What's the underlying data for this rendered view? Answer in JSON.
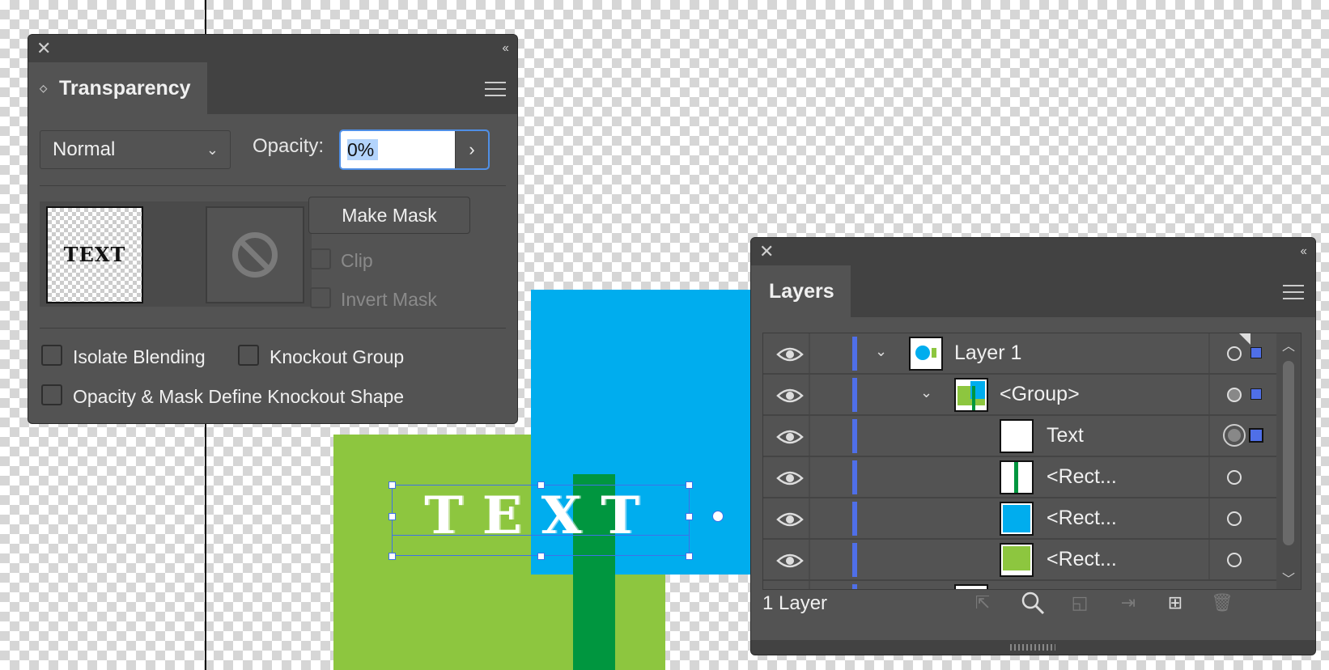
{
  "transparency": {
    "title": "Transparency",
    "blend_mode": "Normal",
    "opacity_label": "Opacity:",
    "opacity_value": "0%",
    "thumbnail_text": "TEXT",
    "make_mask_label": "Make Mask",
    "clip_label": "Clip",
    "invert_mask_label": "Invert Mask",
    "isolate_blending_label": "Isolate Blending",
    "knockout_group_label": "Knockout Group",
    "opacity_mask_knockout_label": "Opacity & Mask Define Knockout Shape"
  },
  "layers": {
    "title": "Layers",
    "rows": [
      {
        "name": "Layer 1"
      },
      {
        "name": "<Group>"
      },
      {
        "name": "Text"
      },
      {
        "name": "<Rect..."
      },
      {
        "name": "<Rect..."
      },
      {
        "name": "<Rect..."
      }
    ],
    "footer_label": "1 Layer"
  },
  "artwork": {
    "text": "TEXT"
  },
  "colors": {
    "artwork_green": "#8dc63f",
    "artwork_blue": "#00adee",
    "artwork_dark_green": "#00963f",
    "layer_color": "#4f6fe8",
    "focus_blue": "#4f8fe6"
  },
  "icons": [
    "close-icon",
    "collapse-icon",
    "panel-menu-icon",
    "chevron-down-icon",
    "chevron-right-icon",
    "no-mask-icon",
    "eye-icon",
    "search-icon",
    "trash-icon"
  ]
}
